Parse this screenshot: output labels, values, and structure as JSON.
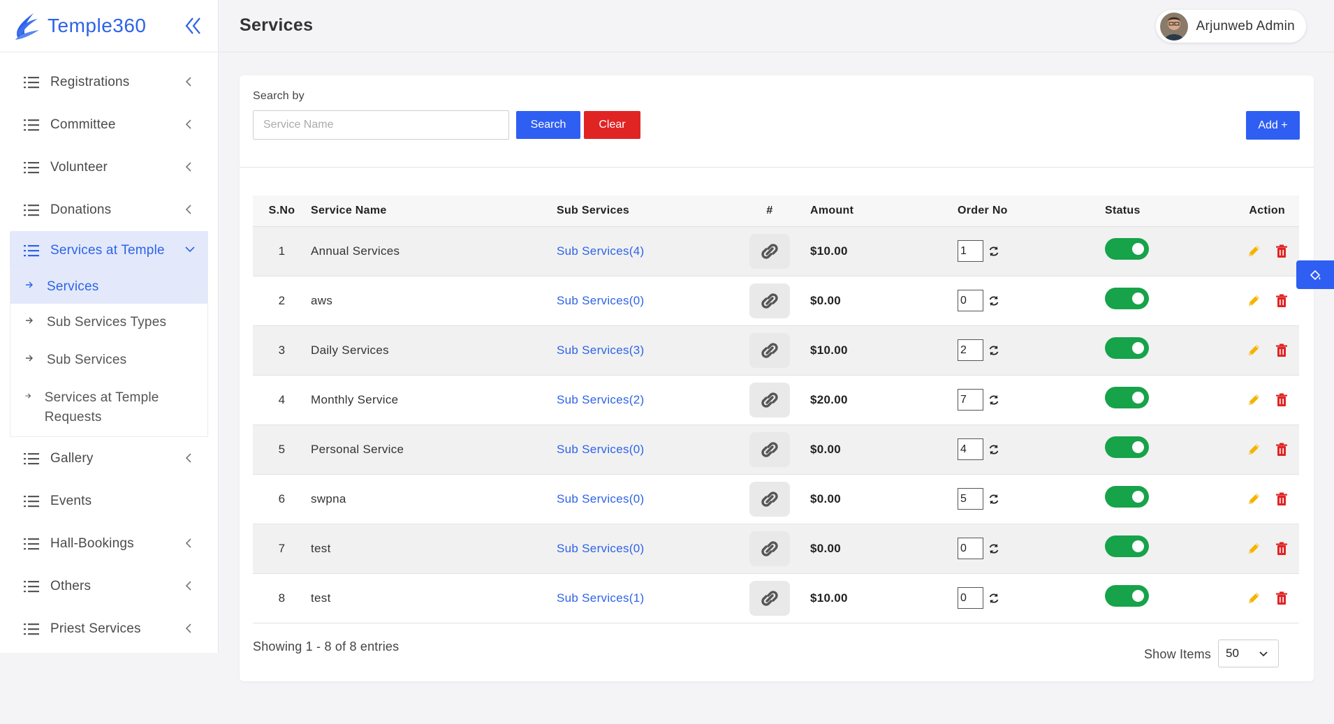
{
  "app": {
    "name": "Temple360"
  },
  "header": {
    "title": "Services",
    "user_name": "Arjunweb Admin"
  },
  "sidebar": {
    "items_before": [
      {
        "label": "Registrations",
        "has_children": true
      },
      {
        "label": "Committee",
        "has_children": true
      },
      {
        "label": "Volunteer",
        "has_children": true
      },
      {
        "label": "Donations",
        "has_children": true
      }
    ],
    "active_section": {
      "label": "Services at Temple"
    },
    "sub_items": [
      {
        "label": "Services",
        "active": true
      },
      {
        "label": "Sub Services Types",
        "active": false
      },
      {
        "label": "Sub Services",
        "active": false
      },
      {
        "label": "Services at Temple Requests",
        "active": false
      }
    ],
    "items_after": [
      {
        "label": "Gallery",
        "has_children": true
      },
      {
        "label": "Events",
        "has_children": false
      },
      {
        "label": "Hall-Bookings",
        "has_children": true
      },
      {
        "label": "Others",
        "has_children": true
      },
      {
        "label": "Priest Services",
        "has_children": true
      }
    ]
  },
  "search": {
    "label": "Search by",
    "placeholder": "Service Name",
    "value": "",
    "search_button": "Search",
    "clear_button": "Clear",
    "add_button": "Add +"
  },
  "table": {
    "headers": {
      "sno": "S.No",
      "name": "Service Name",
      "sub": "Sub Services",
      "hash": "#",
      "amount": "Amount",
      "order": "Order No",
      "status": "Status",
      "action": "Action"
    },
    "rows": [
      {
        "sno": "1",
        "name": "Annual Services",
        "sub": "Sub Services(4)",
        "amount": "$10.00",
        "order": "1",
        "status": true
      },
      {
        "sno": "2",
        "name": "aws",
        "sub": "Sub Services(0)",
        "amount": "$0.00",
        "order": "0",
        "status": true
      },
      {
        "sno": "3",
        "name": "Daily Services",
        "sub": "Sub Services(3)",
        "amount": "$10.00",
        "order": "2",
        "status": true
      },
      {
        "sno": "4",
        "name": "Monthly Service",
        "sub": "Sub Services(2)",
        "amount": "$20.00",
        "order": "7",
        "status": true
      },
      {
        "sno": "5",
        "name": "Personal Service",
        "sub": "Sub Services(0)",
        "amount": "$0.00",
        "order": "4",
        "status": true
      },
      {
        "sno": "6",
        "name": "swpna",
        "sub": "Sub Services(0)",
        "amount": "$0.00",
        "order": "5",
        "status": true
      },
      {
        "sno": "7",
        "name": "test",
        "sub": "Sub Services(0)",
        "amount": "$0.00",
        "order": "0",
        "status": true
      },
      {
        "sno": "8",
        "name": "test",
        "sub": "Sub Services(1)",
        "amount": "$10.00",
        "order": "0",
        "status": true
      }
    ]
  },
  "footer": {
    "showing": "Showing 1 - 8 of 8 entries",
    "show_items_label": "Show Items",
    "show_items_value": "50"
  },
  "colors": {
    "primary": "#2f5ef2",
    "danger": "#e02424",
    "success": "#16a34a",
    "edit": "#f5b301",
    "link": "#2d63e8"
  }
}
